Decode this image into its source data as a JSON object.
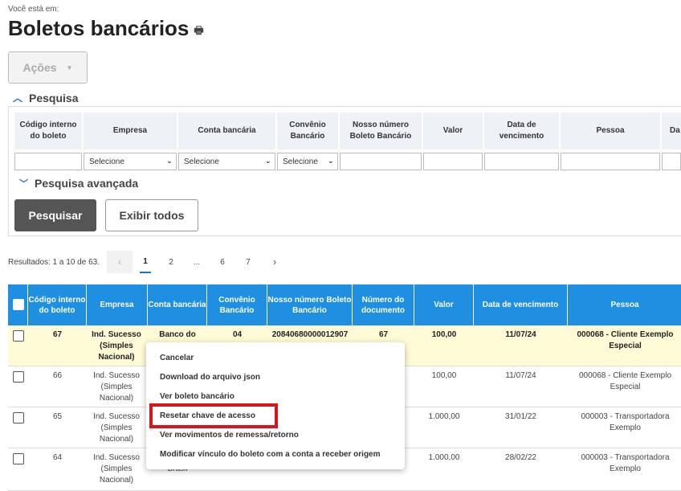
{
  "breadcrumb": "Você está em:",
  "page_title": "Boletos bancários",
  "actions_label": "Ações",
  "search": {
    "title": "Pesquisa",
    "columns": [
      "Código interno do boleto",
      "Empresa",
      "Conta bancária",
      "Convênio Bancário",
      "Nosso número Boleto Bancário",
      "Valor",
      "Data de vencimento",
      "Pessoa",
      "Da"
    ],
    "select_placeholder": "Selecione",
    "advanced_label": "Pesquisa avançada",
    "search_button": "Pesquisar",
    "show_all_button": "Exibir todos"
  },
  "results": {
    "summary": "Resultados: 1 a 10 de 63.",
    "pages": [
      "1",
      "2",
      "...",
      "6",
      "7"
    ],
    "prev": "‹",
    "next": "›"
  },
  "table": {
    "headers": [
      "Código interno do boleto",
      "Empresa",
      "Conta bancária",
      "Convênio Bancário",
      "Nosso número Boleto Bancário",
      "Número do documento",
      "Valor",
      "Data de vencimento",
      "Pessoa"
    ],
    "rows": [
      {
        "codigo": "67",
        "empresa": "Ind. Sucesso (Simples Nacional)",
        "conta": "Banco do",
        "convenio": "04",
        "nosso": "20840680000012907",
        "numero": "67",
        "valor": "100,00",
        "data": "11/07/24",
        "pessoa": "000068 - Cliente Exemplo Especial"
      },
      {
        "codigo": "66",
        "empresa": "Ind. Sucesso (Simples Nacional)",
        "conta": "",
        "convenio": "",
        "nosso": "",
        "numero": "",
        "valor": "100,00",
        "data": "11/07/24",
        "pessoa": "000068 - Cliente Exemplo Especial"
      },
      {
        "codigo": "65",
        "empresa": "Ind. Sucesso (Simples Nacional)",
        "conta": "",
        "convenio": "",
        "nosso": "",
        "numero": "",
        "valor": "1.000,00",
        "data": "31/01/22",
        "pessoa": "000003 - Transportadora Exemplo"
      },
      {
        "codigo": "64",
        "empresa": "Ind. Sucesso (Simples Nacional)",
        "conta": "Brasil",
        "convenio": "",
        "nosso": "",
        "numero": "",
        "valor": "1.000,00",
        "data": "28/02/22",
        "pessoa": "000003 - Transportadora Exemplo"
      }
    ]
  },
  "context_menu": {
    "items": [
      "Cancelar",
      "Download do arquivo json",
      "Ver boleto bancário",
      "Resetar chave de acesso",
      "Ver movimentos de remessa/retorno",
      "Modificar vínculo do boleto com a conta a receber origem"
    ],
    "highlighted_color": "#d9141b"
  },
  "colors": {
    "header_blue": "#1e8fe1",
    "row_highlight": "#fffbd6"
  }
}
